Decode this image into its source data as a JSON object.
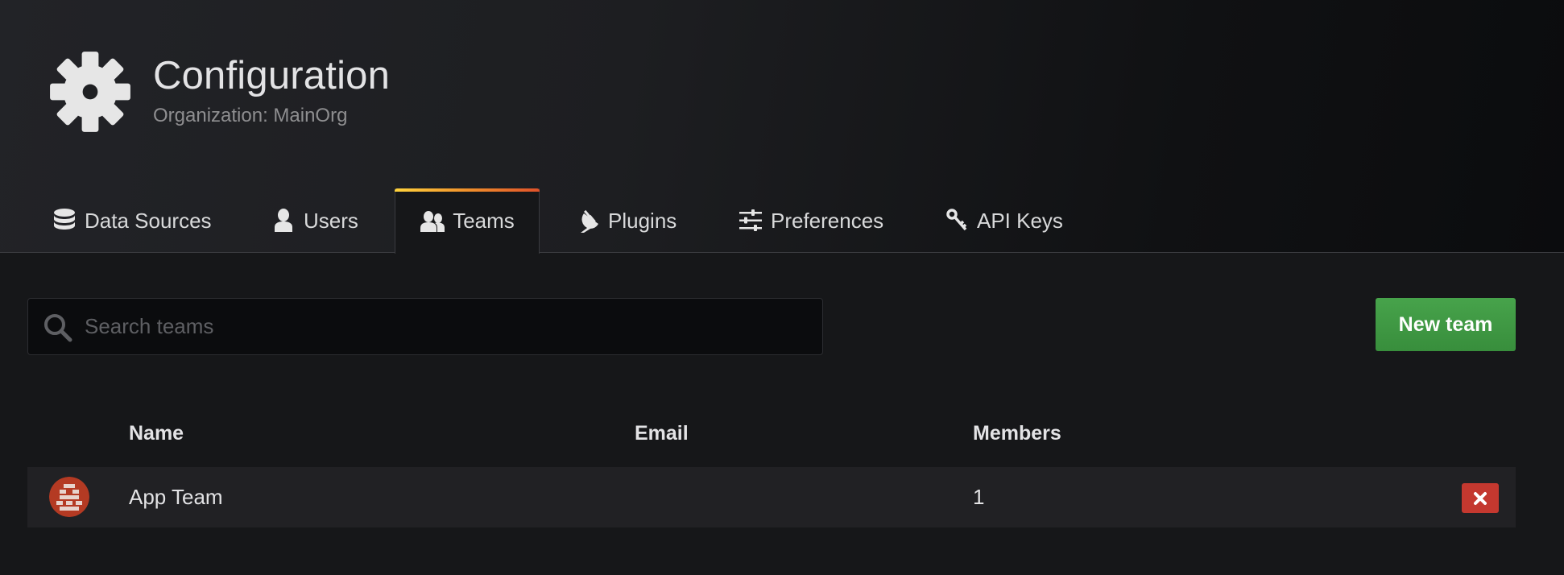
{
  "header": {
    "title": "Configuration",
    "subtitle": "Organization: MainOrg",
    "icon": "gear-icon"
  },
  "tabs": [
    {
      "label": "Data Sources",
      "icon": "database-icon",
      "active": false
    },
    {
      "label": "Users",
      "icon": "user-icon",
      "active": false
    },
    {
      "label": "Teams",
      "icon": "users-icon",
      "active": true
    },
    {
      "label": "Plugins",
      "icon": "plug-icon",
      "active": false
    },
    {
      "label": "Preferences",
      "icon": "sliders-icon",
      "active": false
    },
    {
      "label": "API Keys",
      "icon": "key-icon",
      "active": false
    }
  ],
  "search": {
    "placeholder": "Search teams",
    "value": ""
  },
  "actions": {
    "new_team_label": "New team"
  },
  "table": {
    "columns": [
      "Name",
      "Email",
      "Members"
    ],
    "rows": [
      {
        "name": "App Team",
        "email": "",
        "members": "1"
      }
    ]
  },
  "colors": {
    "accent_gradient": [
      "#ffd33d",
      "#f0902b",
      "#e0522a"
    ],
    "primary_button": "#3f9a43",
    "danger_button": "#c4382f",
    "avatar_bg": "#b43a23"
  }
}
